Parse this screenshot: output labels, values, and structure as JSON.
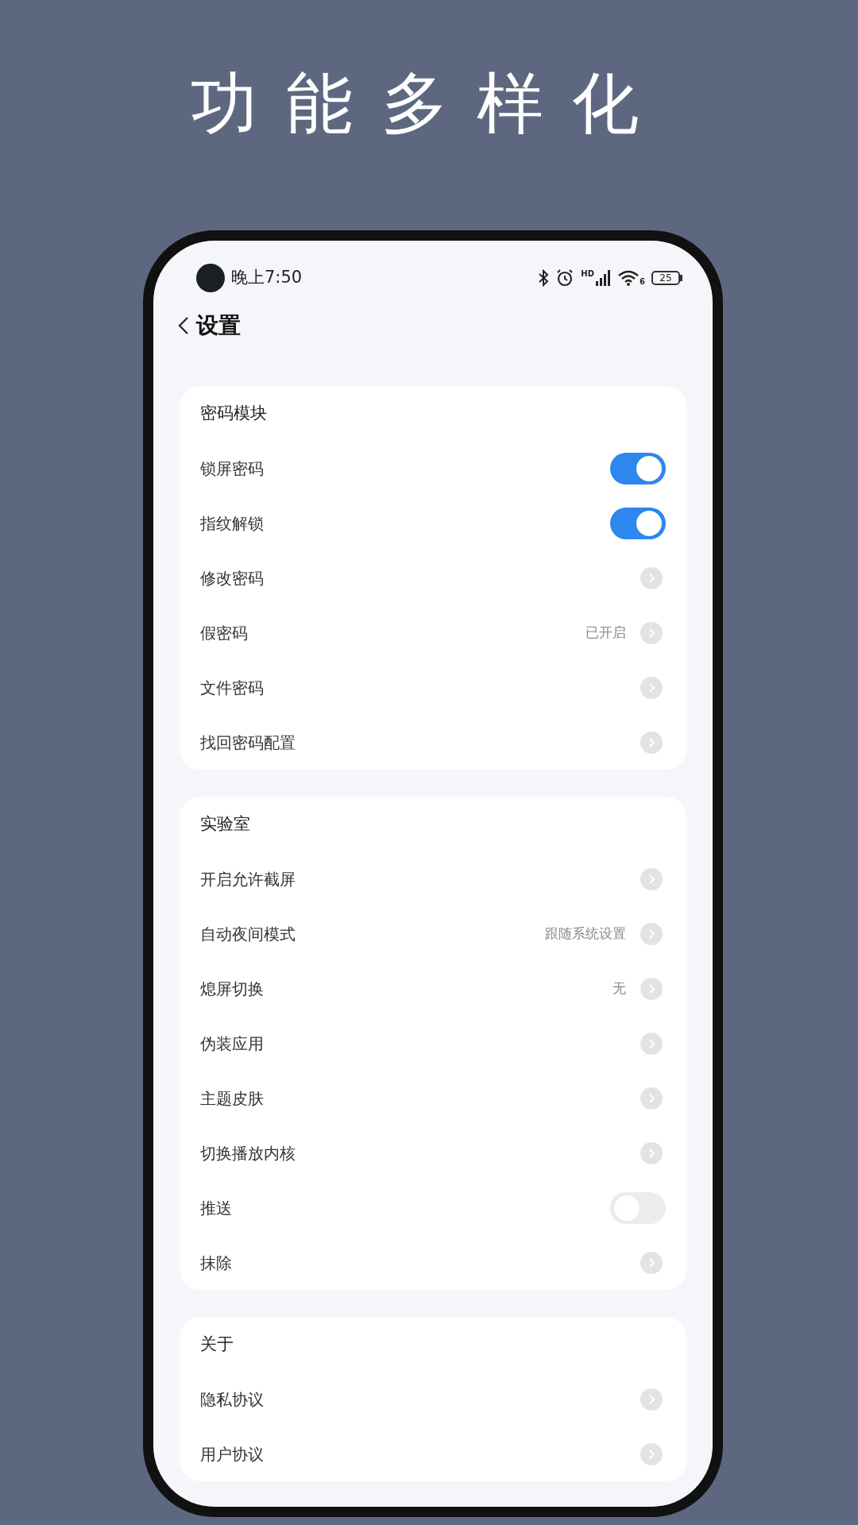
{
  "headline": "功能多样化",
  "status_bar": {
    "time": "晚上7:50",
    "signal_label": "HD",
    "wifi_label": "6",
    "battery": "25"
  },
  "header": {
    "title": "设置"
  },
  "sections": [
    {
      "title": "密码模块",
      "items": [
        {
          "label": "锁屏密码",
          "kind": "toggle",
          "on": true
        },
        {
          "label": "指纹解锁",
          "kind": "toggle",
          "on": true
        },
        {
          "label": "修改密码",
          "kind": "link"
        },
        {
          "label": "假密码",
          "kind": "link",
          "value": "已开启"
        },
        {
          "label": "文件密码",
          "kind": "link"
        },
        {
          "label": "找回密码配置",
          "kind": "link"
        }
      ]
    },
    {
      "title": "实验室",
      "items": [
        {
          "label": "开启允许截屏",
          "kind": "link"
        },
        {
          "label": "自动夜间模式",
          "kind": "link",
          "value": "跟随系统设置"
        },
        {
          "label": "熄屏切换",
          "kind": "link",
          "value": "无"
        },
        {
          "label": "伪装应用",
          "kind": "link"
        },
        {
          "label": "主题皮肤",
          "kind": "link"
        },
        {
          "label": "切换播放内核",
          "kind": "link"
        },
        {
          "label": "推送",
          "kind": "toggle",
          "on": false
        },
        {
          "label": "抹除",
          "kind": "link"
        }
      ]
    },
    {
      "title": "关于",
      "items": [
        {
          "label": "隐私协议",
          "kind": "link"
        },
        {
          "label": "用户协议",
          "kind": "link"
        }
      ]
    }
  ]
}
